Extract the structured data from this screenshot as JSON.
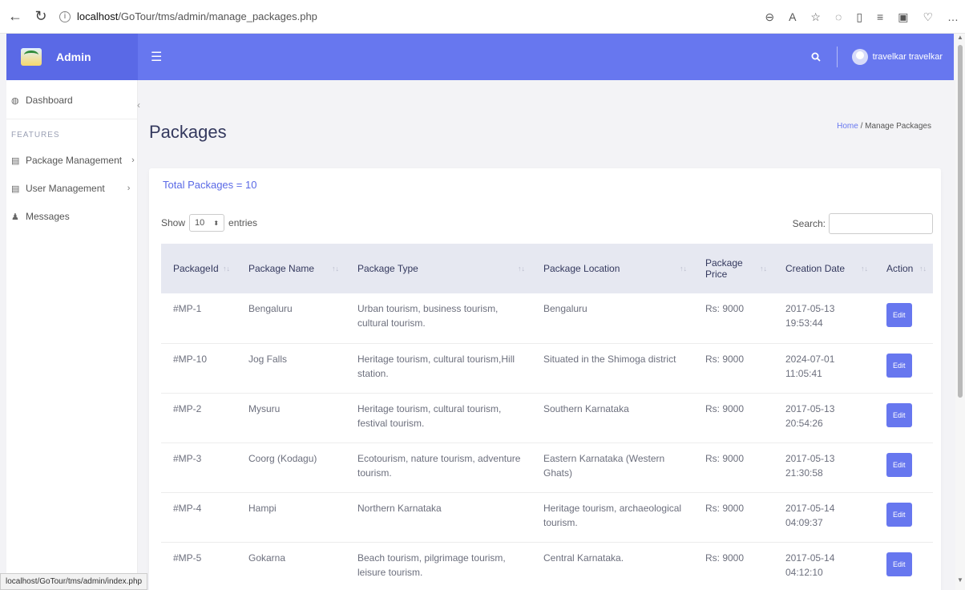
{
  "browser": {
    "url_host": "localhost",
    "url_path": "/GoTour/tms/admin/manage_packages.php"
  },
  "header": {
    "brand": "Admin",
    "menu_icon": "hamburger-icon",
    "search_icon": "search-icon",
    "user_name": "travelkar travelkar",
    "accent_color": "#6777ef"
  },
  "sidebar": {
    "dashboard": "Dashboard",
    "features_heading": "FEATURES",
    "items": [
      {
        "label": "Package Management",
        "icon": "list-icon"
      },
      {
        "label": "User Management",
        "icon": "list-icon"
      },
      {
        "label": "Messages",
        "icon": "user-icon"
      }
    ]
  },
  "page": {
    "title": "Packages",
    "breadcrumb_home": "Home",
    "breadcrumb_sep": "/",
    "breadcrumb_current": "Manage Packages"
  },
  "card": {
    "total": "Total Packages = 10",
    "show_label": "Show",
    "entries_value": "10",
    "entries_label": "entries",
    "search_label": "Search:"
  },
  "table": {
    "columns": [
      "PackageId",
      "Package Name",
      "Package Type",
      "Package Location",
      "Package Price",
      "Creation Date",
      "Action"
    ],
    "rows": [
      {
        "id": "#MP-1",
        "name": "Bengaluru",
        "type": "Urban tourism, business tourism, cultural tourism.",
        "location": "Bengaluru",
        "price": "Rs: 9000",
        "date": "2017-05-13 19:53:44",
        "action": "Edit"
      },
      {
        "id": "#MP-10",
        "name": "Jog Falls",
        "type": "Heritage tourism, cultural tourism,Hill station.",
        "location": "Situated in the Shimoga district",
        "price": "Rs: 9000",
        "date": "2024-07-01 11:05:41",
        "action": "Edit"
      },
      {
        "id": "#MP-2",
        "name": "Mysuru",
        "type": "Heritage tourism, cultural tourism, festival tourism.",
        "location": "Southern Karnataka",
        "price": "Rs: 9000",
        "date": "2017-05-13 20:54:26",
        "action": "Edit"
      },
      {
        "id": "#MP-3",
        "name": "Coorg (Kodagu)",
        "type": "Ecotourism, nature tourism, adventure tourism.",
        "location": "Eastern Karnataka (Western Ghats)",
        "price": "Rs: 9000",
        "date": "2017-05-13 21:30:58",
        "action": "Edit"
      },
      {
        "id": "#MP-4",
        "name": "Hampi",
        "type": "Northern Karnataka",
        "location": "Heritage tourism, archaeological tourism.",
        "price": "Rs: 9000",
        "date": "2017-05-14 04:09:37",
        "action": "Edit"
      },
      {
        "id": "#MP-5",
        "name": "Gokarna",
        "type": "Beach tourism, pilgrimage tourism, leisure tourism.",
        "location": "Central Karnataka.",
        "price": "Rs: 9000",
        "date": "2017-05-14 04:12:10",
        "action": "Edit"
      }
    ]
  },
  "status_bar": "localhost/GoTour/tms/admin/index.php"
}
